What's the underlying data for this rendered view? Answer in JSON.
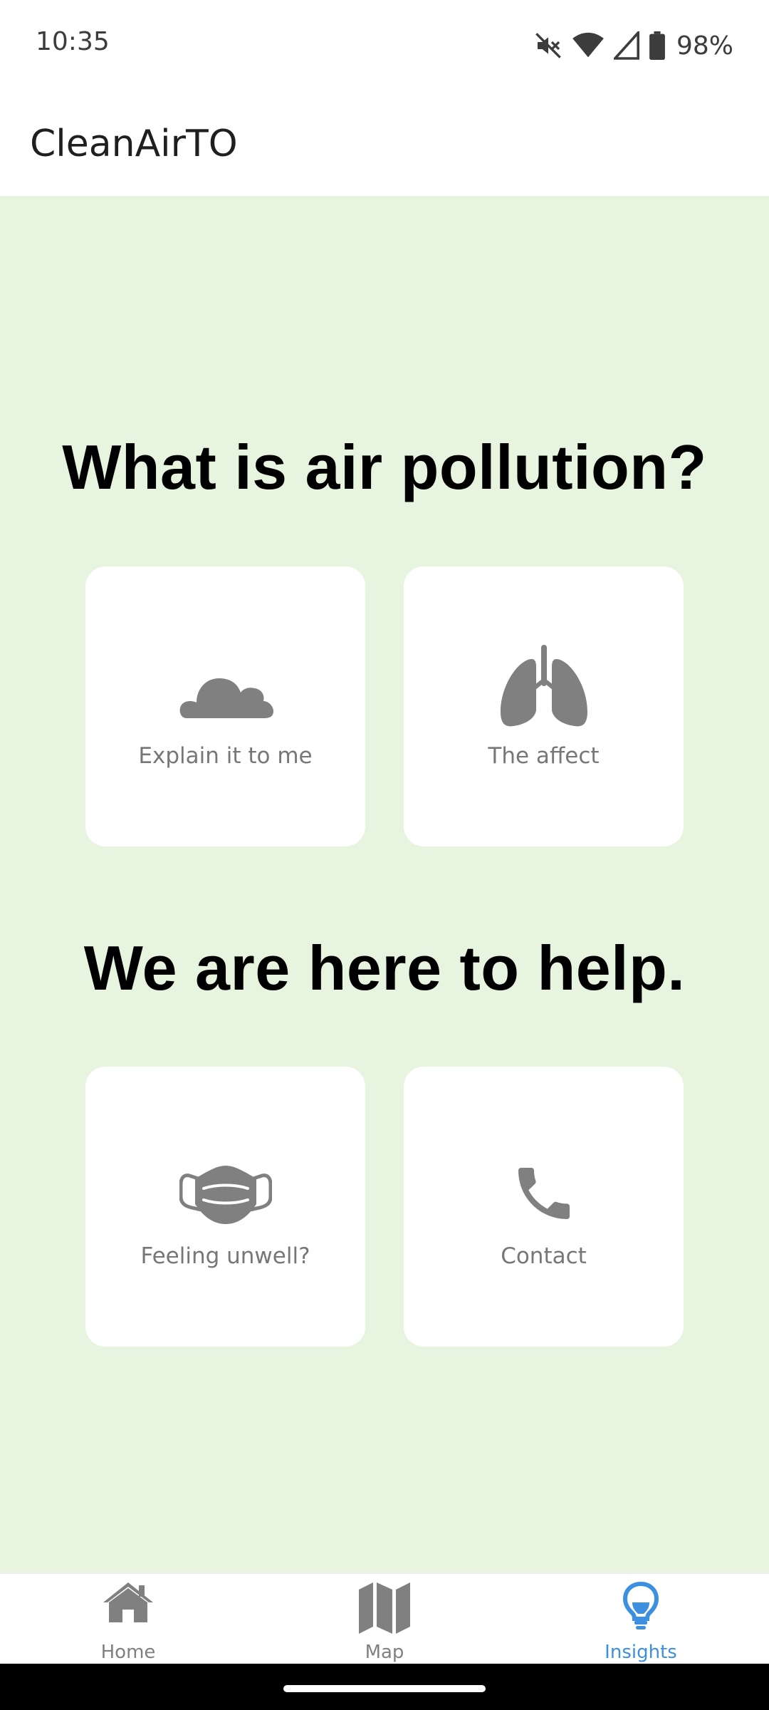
{
  "status_bar": {
    "time": "10:35",
    "battery": "98%",
    "icons": [
      "mute-icon",
      "wifi-icon",
      "signal-icon",
      "battery-icon"
    ]
  },
  "app_bar": {
    "title": "CleanAirTO"
  },
  "sections": [
    {
      "heading": "What is air pollution?",
      "cards": [
        {
          "label": "Explain it to me",
          "icon": "cloud-icon"
        },
        {
          "label": "The affect",
          "icon": "lungs-icon"
        }
      ]
    },
    {
      "heading": "We are here to help.",
      "cards": [
        {
          "label": "Feeling unwell?",
          "icon": "face-mask-icon"
        },
        {
          "label": "Contact",
          "icon": "phone-icon"
        }
      ]
    }
  ],
  "bottom_nav": {
    "items": [
      {
        "label": "Home",
        "icon": "home-icon",
        "active": false
      },
      {
        "label": "Map",
        "icon": "map-icon",
        "active": false
      },
      {
        "label": "Insights",
        "icon": "lightbulb-icon",
        "active": true
      }
    ]
  },
  "colors": {
    "content_background": "#e7f4df",
    "card_background": "#ffffff",
    "icon_gray": "#808080",
    "active_blue": "#3d8fe0"
  }
}
